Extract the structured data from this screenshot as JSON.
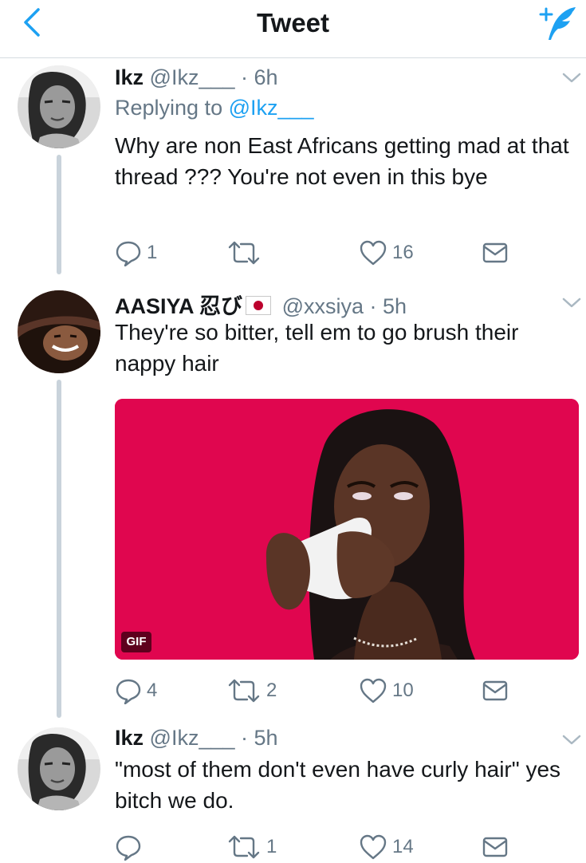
{
  "header": {
    "title": "Tweet",
    "back_icon": "chevron-left-icon",
    "compose_icon": "compose-tweet-icon"
  },
  "colors": {
    "accent": "#1da1f2",
    "text": "#14171a",
    "secondary": "#657786",
    "thread_line": "#c9d3db",
    "gif_background": "#e0064f"
  },
  "tweets": [
    {
      "name": "Ikz",
      "handle": "@Ikz___",
      "time": "· 6h",
      "replying_label": "Replying to",
      "replying_handle": "@Ikz___",
      "text": "Why are non East Africans getting mad at that thread ??? You're not even in this bye",
      "replies": "1",
      "retweets": "",
      "likes": "16"
    },
    {
      "name": "AASIYA 忍び",
      "flag": "flag-japan-icon",
      "handle": "@xxsiya",
      "time": "· 5h",
      "text": "They're so bitter, tell em to go brush their nappy hair",
      "media_label": "GIF",
      "replies": "4",
      "retweets": "2",
      "likes": "10"
    },
    {
      "name": "Ikz",
      "handle": "@Ikz___",
      "time": "· 5h",
      "text": "\"most of them don't even have curly hair\" yes bitch we do.",
      "replies": "",
      "retweets": "1",
      "likes": "14"
    }
  ]
}
